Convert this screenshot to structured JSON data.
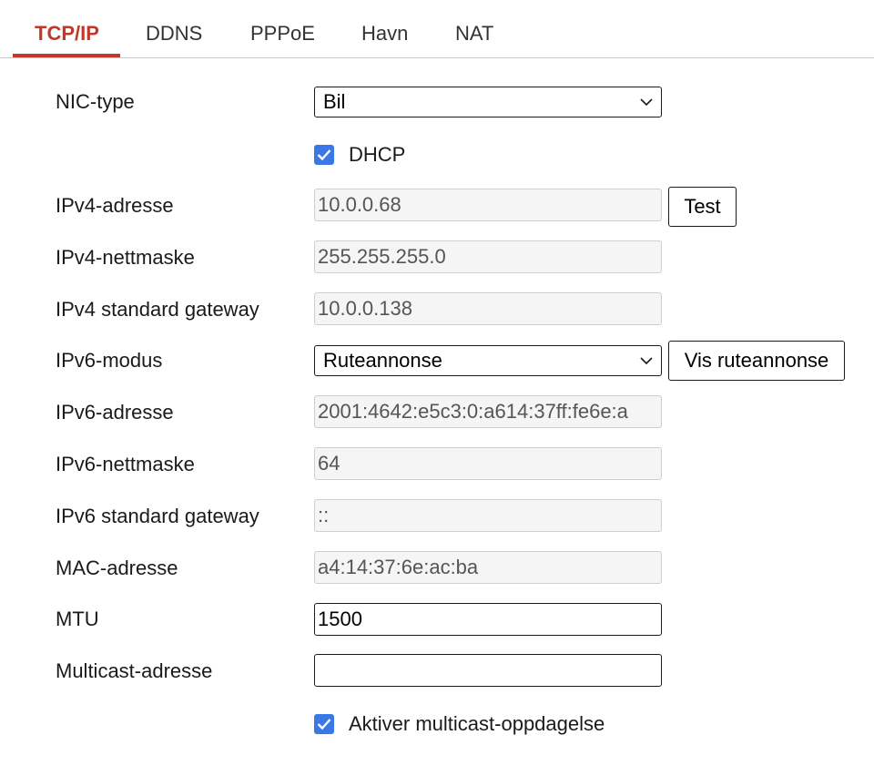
{
  "tabs": [
    "TCP/IP",
    "DDNS",
    "PPPoE",
    "Havn",
    "NAT"
  ],
  "active_tab": "TCP/IP",
  "form": {
    "nic_type": {
      "label": "NIC-type",
      "value": "Bil"
    },
    "dhcp": {
      "label": "DHCP",
      "checked": true
    },
    "ipv4_address": {
      "label": "IPv4-adresse",
      "value": "10.0.0.68"
    },
    "test_button": "Test",
    "ipv4_netmask": {
      "label": "IPv4-nettmaske",
      "value": "255.255.255.0"
    },
    "ipv4_gateway": {
      "label": "IPv4 standard gateway",
      "value": "10.0.0.138"
    },
    "ipv6_mode": {
      "label": "IPv6-modus",
      "value": "Ruteannonse"
    },
    "show_route_button": "Vis ruteannonse",
    "ipv6_address": {
      "label": "IPv6-adresse",
      "value": "2001:4642:e5c3:0:a614:37ff:fe6e:a"
    },
    "ipv6_netmask": {
      "label": "IPv6-nettmaske",
      "value": "64"
    },
    "ipv6_gateway": {
      "label": "IPv6 standard gateway",
      "value": "::"
    },
    "mac_address": {
      "label": "MAC-adresse",
      "value": "a4:14:37:6e:ac:ba"
    },
    "mtu": {
      "label": "MTU",
      "value": "1500"
    },
    "multicast_address": {
      "label": "Multicast-adresse",
      "value": ""
    },
    "multicast_discovery": {
      "label": "Aktiver multicast-oppdagelse",
      "checked": true
    }
  },
  "colors": {
    "accent": "#c0392b",
    "checkbox": "#3b78e7"
  }
}
